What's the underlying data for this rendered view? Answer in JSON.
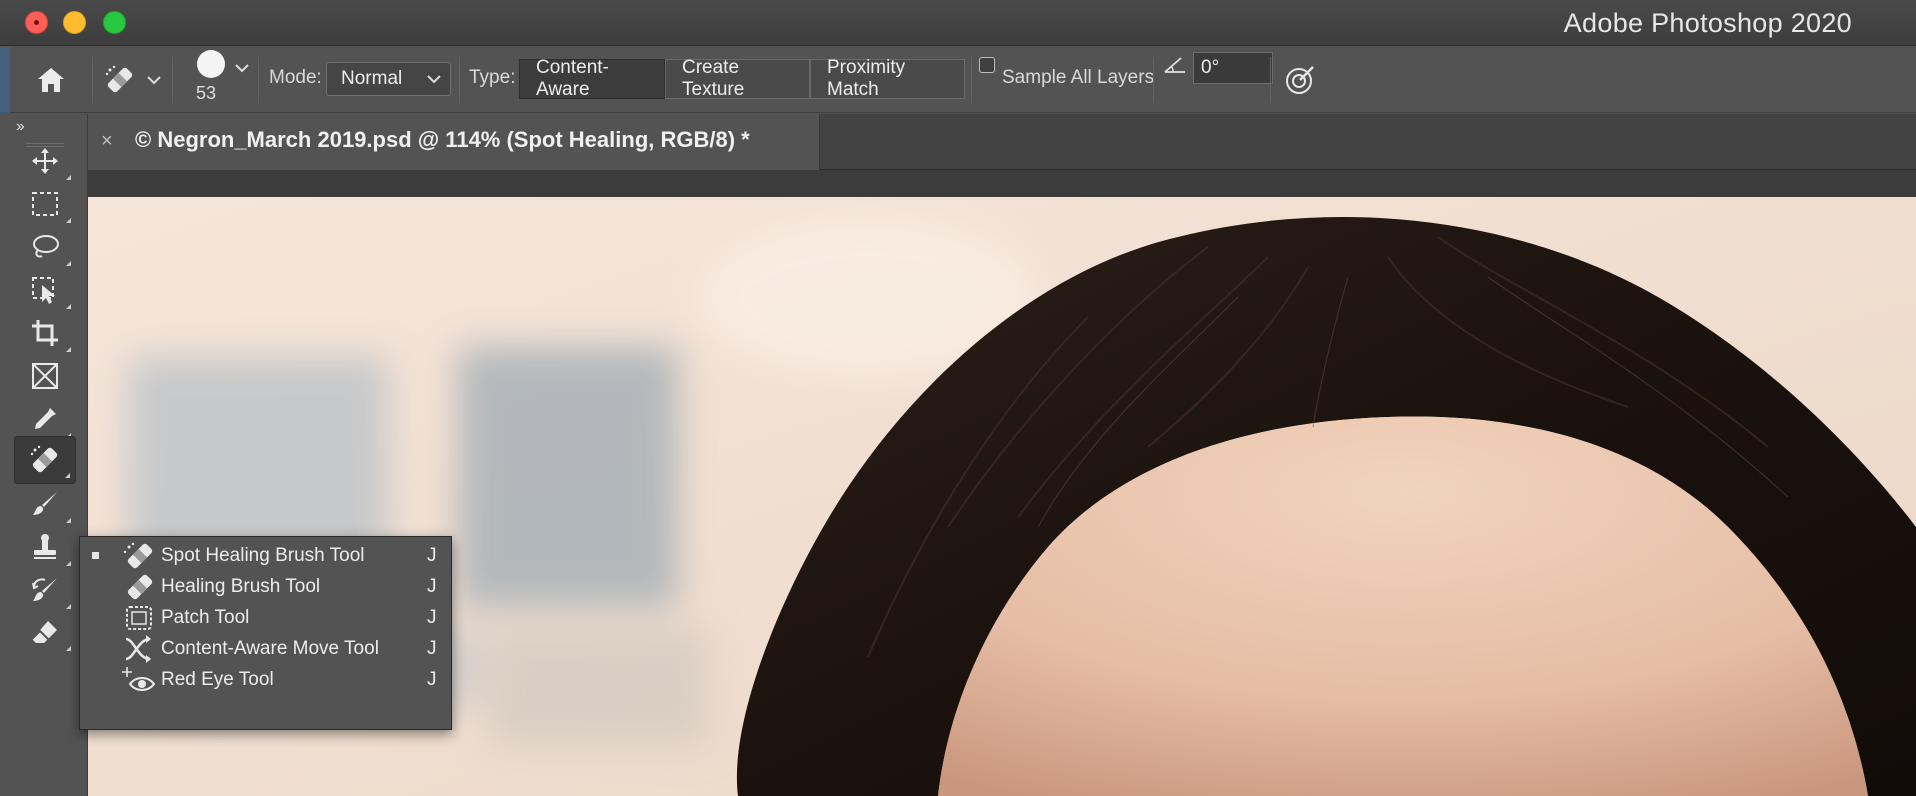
{
  "window": {
    "title": "Adobe Photoshop 2020",
    "traffic_lights": [
      "close",
      "minimize",
      "zoom"
    ]
  },
  "options_bar": {
    "home_icon": "home-icon",
    "tool_icon": "spot-healing-brush-icon",
    "brush_size": "53",
    "mode_label": "Mode:",
    "mode_value": "Normal",
    "type_label": "Type:",
    "type_buttons": [
      "Content-Aware",
      "Create Texture",
      "Proximity Match"
    ],
    "type_selected": "Content-Aware",
    "sample_all_layers_label": "Sample All Layers",
    "sample_all_layers_checked": false,
    "angle_value": "0°",
    "pressure_icon": "pressure-size-icon"
  },
  "document_tab": {
    "close_glyph": "×",
    "title": "© Negron_March 2019.psd @ 114% (Spot Healing, RGB/8) *"
  },
  "toolbar": {
    "collapse_glyph": "››",
    "tools": [
      "move-tool-icon",
      "rectangular-marquee-icon",
      "lasso-icon",
      "object-selection-icon",
      "crop-icon",
      "frame-icon",
      "eyedropper-icon",
      "spot-healing-brush-icon",
      "brush-icon",
      "clone-stamp-icon",
      "history-brush-icon",
      "eraser-icon"
    ],
    "selected_tool": "spot-healing-brush-icon"
  },
  "flyout": {
    "items": [
      {
        "label": "Spot Healing Brush Tool",
        "key": "J",
        "icon": "spot-healing-brush-icon",
        "selected": true
      },
      {
        "label": "Healing Brush Tool",
        "key": "J",
        "icon": "healing-brush-icon",
        "selected": false
      },
      {
        "label": "Patch Tool",
        "key": "J",
        "icon": "patch-icon",
        "selected": false
      },
      {
        "label": "Content-Aware Move Tool",
        "key": "J",
        "icon": "content-aware-move-icon",
        "selected": false
      },
      {
        "label": "Red Eye Tool",
        "key": "J",
        "icon": "red-eye-icon",
        "selected": false
      }
    ]
  },
  "colors": {
    "ui_panel": "#535353",
    "ui_dark": "#3c3c3c",
    "canvas_background": "#f1e2d6",
    "hair": "#1e1410",
    "skin": "#e8c4ad"
  }
}
